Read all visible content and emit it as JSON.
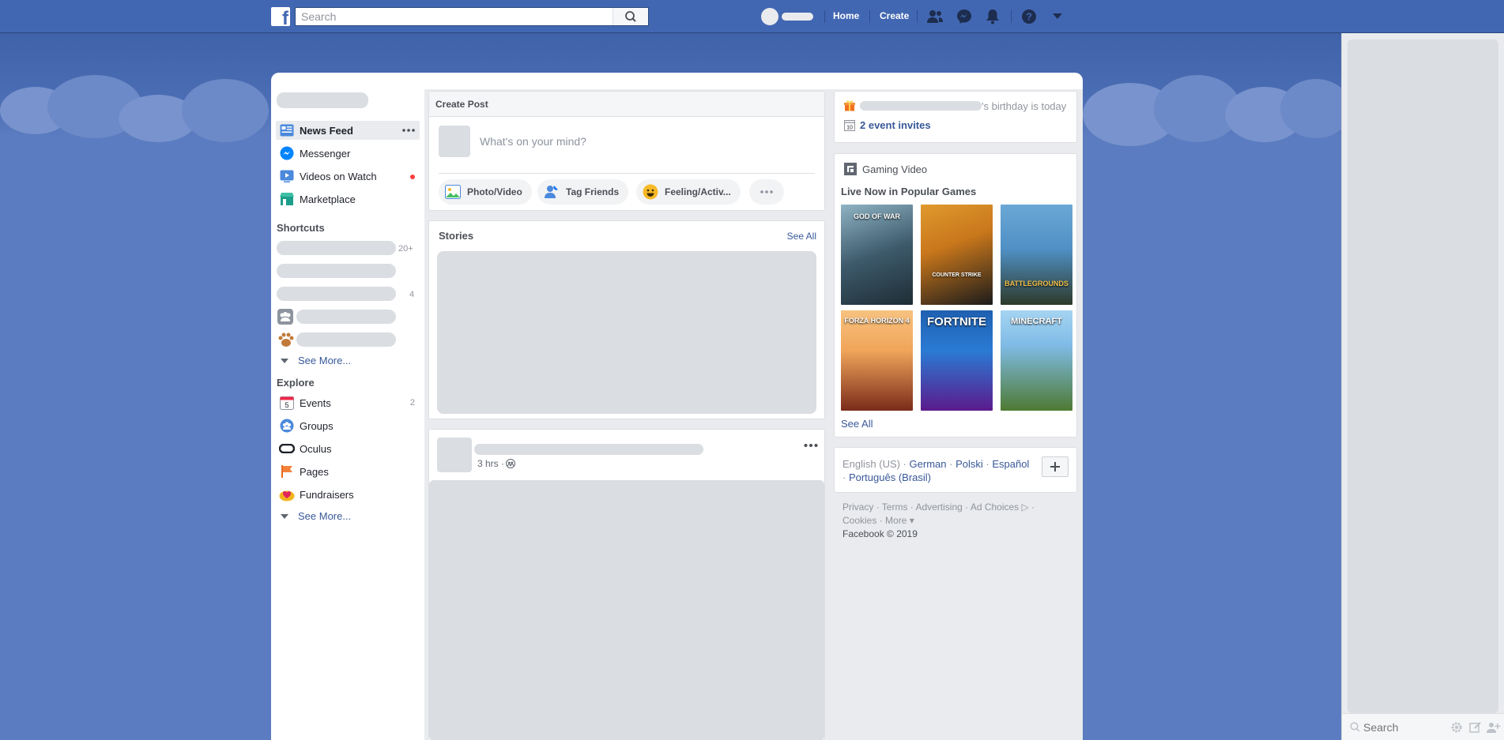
{
  "topbar": {
    "search_placeholder": "Search",
    "nav_home": "Home",
    "nav_create": "Create",
    "brand_color": "#4267b2"
  },
  "leftnav": {
    "items": [
      {
        "label": "News Feed",
        "icon": "news-feed-icon"
      },
      {
        "label": "Messenger",
        "icon": "messenger-icon"
      },
      {
        "label": "Videos on Watch",
        "icon": "watch-icon"
      },
      {
        "label": "Marketplace",
        "icon": "marketplace-icon"
      }
    ],
    "shortcuts_title": "Shortcuts",
    "shortcut_counts": [
      "20+",
      "",
      "4",
      "",
      ""
    ],
    "see_more_1": "See More...",
    "explore_title": "Explore",
    "explore": [
      {
        "label": "Events",
        "count": "2",
        "icon": "events-icon"
      },
      {
        "label": "Groups",
        "count": "",
        "icon": "groups-icon"
      },
      {
        "label": "Oculus",
        "count": "",
        "icon": "oculus-icon"
      },
      {
        "label": "Pages",
        "count": "",
        "icon": "pages-icon"
      },
      {
        "label": "Fundraisers",
        "count": "",
        "icon": "fundraisers-icon"
      }
    ],
    "see_more_2": "See More..."
  },
  "composer": {
    "title": "Create Post",
    "placeholder": "What's on your mind?",
    "buttons": [
      "Photo/Video",
      "Tag Friends",
      "Feeling/Activ..."
    ]
  },
  "stories": {
    "title": "Stories",
    "see_all": "See All"
  },
  "post": {
    "time": "3 hrs ·"
  },
  "rightcol": {
    "birthday_suffix": "'s birthday is today",
    "event_invites": "2 event invites",
    "gaming_title": "Gaming Video",
    "live_now": "Live Now in Popular Games",
    "games": [
      {
        "name": "GOD OF WAR",
        "colors": [
          "#3d5a6b",
          "#1e2d35"
        ]
      },
      {
        "name": "COUNTER STRIKE",
        "colors": [
          "#c9771b",
          "#1b1b1b"
        ]
      },
      {
        "name": "BATTLEGROUNDS",
        "colors": [
          "#4f8fc3",
          "#2e3a2a"
        ]
      },
      {
        "name": "FORZA HORIZON 4",
        "colors": [
          "#f0a55a",
          "#7a2b1a"
        ]
      },
      {
        "name": "FORTNITE",
        "colors": [
          "#2a7bd4",
          "#5b1a8c"
        ]
      },
      {
        "name": "MINECRAFT",
        "colors": [
          "#7fbbe6",
          "#4e7a32"
        ]
      }
    ],
    "see_all": "See All",
    "lang_current": "English (US) ·",
    "languages": [
      "German",
      "Polski",
      "Español",
      "Português (Brasil)"
    ],
    "footer_links_1": "Privacy · Terms · Advertising · Ad Choices ▷ ·",
    "footer_links_2": "Cookies · More ▾",
    "copyright": "Facebook © 2019"
  },
  "chat": {
    "search_placeholder": "Search"
  }
}
